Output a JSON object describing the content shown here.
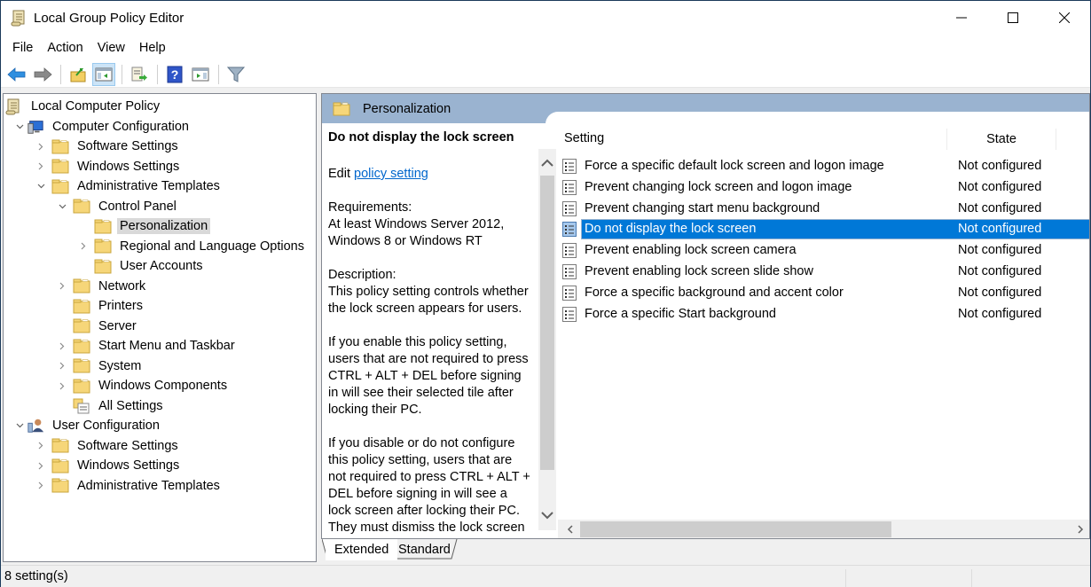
{
  "window": {
    "title": "Local Group Policy Editor",
    "controls": {
      "minimize": "minimize",
      "maximize": "maximize",
      "close": "close"
    }
  },
  "menu": [
    "File",
    "Action",
    "View",
    "Help"
  ],
  "toolbar": {
    "buttons": [
      {
        "name": "back",
        "icon": "back-arrow-icon"
      },
      {
        "name": "forward",
        "icon": "forward-arrow-icon"
      },
      {
        "name": "up-one-level",
        "icon": "folder-up-icon"
      },
      {
        "name": "show-hide-console-tree",
        "icon": "console-tree-icon",
        "active": true
      },
      {
        "name": "export-list",
        "icon": "export-list-icon"
      },
      {
        "name": "help",
        "icon": "help-icon"
      },
      {
        "name": "show-hide-action-pane",
        "icon": "action-pane-icon"
      },
      {
        "name": "filter-options",
        "icon": "filter-icon"
      }
    ]
  },
  "tree": [
    {
      "label": "Local Computer Policy",
      "level": 0,
      "icon": "policy-scroll-icon",
      "expander": "none"
    },
    {
      "label": "Computer Configuration",
      "level": 1,
      "icon": "computer-icon",
      "expander": "expanded"
    },
    {
      "label": "Software Settings",
      "level": 2,
      "icon": "folder-icon",
      "expander": "collapsed"
    },
    {
      "label": "Windows Settings",
      "level": 2,
      "icon": "folder-icon",
      "expander": "collapsed"
    },
    {
      "label": "Administrative Templates",
      "level": 2,
      "icon": "folder-icon",
      "expander": "expanded"
    },
    {
      "label": "Control Panel",
      "level": 3,
      "icon": "folder-icon",
      "expander": "expanded"
    },
    {
      "label": "Personalization",
      "level": 4,
      "icon": "folder-icon",
      "expander": "none",
      "selected": true
    },
    {
      "label": "Regional and Language Options",
      "level": 4,
      "icon": "folder-icon",
      "expander": "collapsed"
    },
    {
      "label": "User Accounts",
      "level": 4,
      "icon": "folder-icon",
      "expander": "none"
    },
    {
      "label": "Network",
      "level": 3,
      "icon": "folder-icon",
      "expander": "collapsed"
    },
    {
      "label": "Printers",
      "level": 3,
      "icon": "folder-icon",
      "expander": "none"
    },
    {
      "label": "Server",
      "level": 3,
      "icon": "folder-icon",
      "expander": "none"
    },
    {
      "label": "Start Menu and Taskbar",
      "level": 3,
      "icon": "folder-icon",
      "expander": "collapsed"
    },
    {
      "label": "System",
      "level": 3,
      "icon": "folder-icon",
      "expander": "collapsed"
    },
    {
      "label": "Windows Components",
      "level": 3,
      "icon": "folder-icon",
      "expander": "collapsed"
    },
    {
      "label": "All Settings",
      "level": 3,
      "icon": "all-settings-icon",
      "expander": "none"
    },
    {
      "label": "User Configuration",
      "level": 1,
      "icon": "user-icon",
      "expander": "expanded"
    },
    {
      "label": "Software Settings",
      "level": 2,
      "icon": "folder-icon",
      "expander": "collapsed"
    },
    {
      "label": "Windows Settings",
      "level": 2,
      "icon": "folder-icon",
      "expander": "collapsed"
    },
    {
      "label": "Administrative Templates",
      "level": 2,
      "icon": "folder-icon",
      "expander": "collapsed"
    }
  ],
  "right": {
    "header_title": "Personalization",
    "description": {
      "title": "Do not display the lock screen",
      "edit_prefix": "Edit ",
      "edit_link": "policy setting ",
      "requirements_label": "Requirements:",
      "requirements_text": "At least Windows Server 2012, Windows 8 or Windows RT",
      "description_label": "Description:",
      "description_text": "This policy setting controls whether the lock screen appears for users.",
      "enable_text": "If you enable this policy setting, users that are not required to press CTRL + ALT + DEL before signing in will see their selected tile after locking their PC.",
      "disable_text": "If you disable or do not configure this policy setting, users that are not required to press CTRL + ALT + DEL before signing in will see a lock screen after locking their PC. They must dismiss the lock screen using touch, the keyboard, or by dragging it with the mouse."
    },
    "list": {
      "columns": {
        "setting": "Setting",
        "state": "State"
      },
      "rows": [
        {
          "setting": "Force a specific default lock screen and logon image",
          "state": "Not configured"
        },
        {
          "setting": "Prevent changing lock screen and logon image",
          "state": "Not configured"
        },
        {
          "setting": "Prevent changing start menu background",
          "state": "Not configured"
        },
        {
          "setting": "Do not display the lock screen",
          "state": "Not configured",
          "selected": true
        },
        {
          "setting": "Prevent enabling lock screen camera",
          "state": "Not configured"
        },
        {
          "setting": "Prevent enabling lock screen slide show",
          "state": "Not configured"
        },
        {
          "setting": "Force a specific background and accent color",
          "state": "Not configured"
        },
        {
          "setting": "Force a specific Start background",
          "state": "Not configured"
        }
      ]
    },
    "tabs": [
      {
        "label": "Extended",
        "active": true
      },
      {
        "label": "Standard",
        "active": false
      }
    ]
  },
  "status": {
    "text": "8 setting(s)"
  },
  "colors": {
    "selection": "#0078d7",
    "header_band": "#9ab3d0",
    "link": "#0066cc",
    "tree_selected": "#d9d9d9"
  }
}
